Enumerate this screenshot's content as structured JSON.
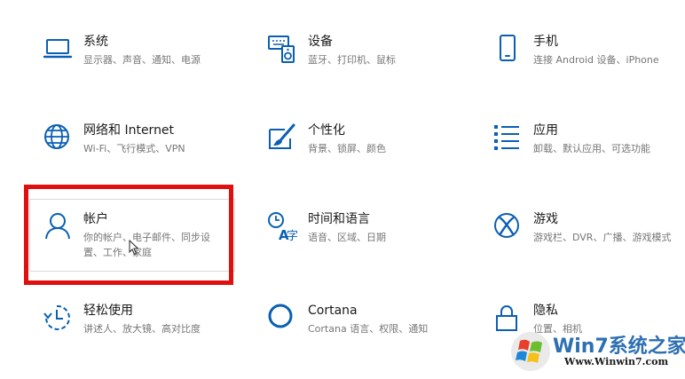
{
  "settings": {
    "tiles": [
      {
        "key": "system",
        "title": "系统",
        "subtitle": "显示器、声音、通知、电源"
      },
      {
        "key": "devices",
        "title": "设备",
        "subtitle": "蓝牙、打印机、鼠标"
      },
      {
        "key": "phone",
        "title": "手机",
        "subtitle": "连接 Android 设备、iPhone"
      },
      {
        "key": "network",
        "title": "网络和 Internet",
        "subtitle": "Wi-Fi、飞行模式、VPN"
      },
      {
        "key": "personalization",
        "title": "个性化",
        "subtitle": "背景、锁屏、颜色"
      },
      {
        "key": "apps",
        "title": "应用",
        "subtitle": "卸载、默认应用、可选功能"
      },
      {
        "key": "accounts",
        "title": "帐户",
        "subtitle_line1": "你的帐户、电子邮件、同步设",
        "subtitle_line2": "置、工作、家庭"
      },
      {
        "key": "time_language",
        "title": "时间和语言",
        "subtitle": "语音、区域、日期"
      },
      {
        "key": "gaming",
        "title": "游戏",
        "subtitle": "游戏栏、DVR、广播、游戏模式"
      },
      {
        "key": "ease_of_access",
        "title": "轻松使用",
        "subtitle": "讲述人、放大镜、高对比度"
      },
      {
        "key": "cortana",
        "title": "Cortana",
        "subtitle": "Cortana 语言、权限、通知"
      },
      {
        "key": "privacy",
        "title": "隐私",
        "subtitle": "位置、相机"
      }
    ]
  },
  "watermark": {
    "brand": "Win7系统之家",
    "url": "Www.Winwin7.com"
  },
  "colors": {
    "icon_accent": "#0a5fb4",
    "highlight": "#e01010"
  },
  "icons": [
    "laptop-icon",
    "keyboard-speaker-icon",
    "phone-icon",
    "globe-icon",
    "paint-brush-icon",
    "app-list-icon",
    "person-icon",
    "clock-language-icon",
    "xbox-icon",
    "ease-of-access-icon",
    "cortana-ring-icon",
    "lock-icon"
  ]
}
